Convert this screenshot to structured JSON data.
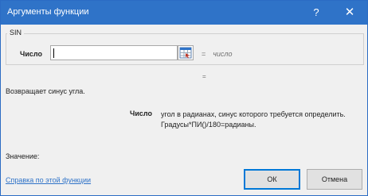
{
  "window": {
    "title": "Аргументы функции",
    "help_glyph": "?",
    "close_glyph": "✕"
  },
  "function_group": {
    "name": "SIN",
    "arg_label": "Число",
    "arg_value": "",
    "arg_result_eq": "=",
    "arg_result": "число"
  },
  "result_eq": "=",
  "description": "Возвращает синус угла.",
  "argument_help": {
    "name": "Число",
    "line1": "угол в радианах, синус которого требуется определить.",
    "line2": "Градусы*ПИ()/180=радианы."
  },
  "value_label": "Значение:",
  "help_link": "Справка по этой функции",
  "buttons": {
    "ok": "ОК",
    "cancel": "Отмена"
  },
  "colors": {
    "titlebar": "#2f73c8",
    "link": "#2f73c8",
    "ok_border": "#0078d7"
  }
}
